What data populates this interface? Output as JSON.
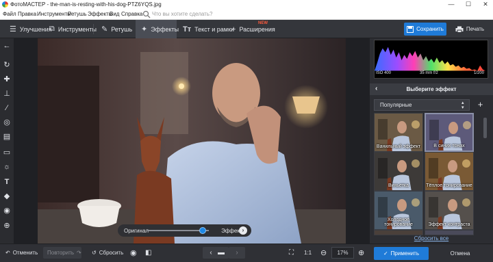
{
  "app": {
    "title": "ФотоМАСТЕР - the-man-is-resting-with-his-dog-PTZ6YQS.jpg"
  },
  "window_controls": {
    "minimize": "—",
    "maximize": "☐",
    "close": "✕"
  },
  "menu": {
    "items": [
      "Файл",
      "Правка",
      "Инструменты",
      "Ретушь",
      "Эффекты",
      "Вид",
      "Справка"
    ],
    "search_placeholder": "Что вы хотите сделать?"
  },
  "toolbar": {
    "tabs": [
      {
        "label": "Улучшения",
        "icon": "sliders-icon"
      },
      {
        "label": "Инструменты",
        "icon": "crop-icon"
      },
      {
        "label": "Ретушь",
        "icon": "brush-icon"
      },
      {
        "label": "Эффекты",
        "icon": "magic-wand-icon"
      },
      {
        "label": "Текст и рамки",
        "icon": "text-icon"
      },
      {
        "label": "Расширения",
        "icon": "plus-icon"
      }
    ],
    "new_badge": "NEW",
    "save_label": "Сохранить",
    "print_label": "Печать"
  },
  "left_tools": [
    "back-arrow-icon",
    "rotate-icon",
    "healing-patch-icon",
    "stamp-icon",
    "brush-icon",
    "radial-filter-icon",
    "gradient-filter-icon",
    "vignette-icon",
    "light-icon",
    "text-icon",
    "fill-icon",
    "red-eye-icon",
    "target-icon"
  ],
  "compare": {
    "left_label": "Оригинал",
    "right_label": "Эффект",
    "position": 0.9
  },
  "histogram": {
    "iso": "ISO 400",
    "lens": "35 mm f/2",
    "shutter": "1/200"
  },
  "effects": {
    "header": "Выберите эффект",
    "category": "Популярные",
    "thumbs": [
      {
        "label": "Ванильный эффект",
        "selected": false
      },
      {
        "label": "В синих тонах",
        "selected": true
      },
      {
        "label": "Виньетка",
        "selected": false
      },
      {
        "label": "Тёплое тонирование",
        "selected": false
      },
      {
        "label": "Холодное тонирование",
        "selected": false
      },
      {
        "label": "Эффект контраста",
        "selected": false
      },
      {
        "label": "",
        "selected": false
      },
      {
        "label": "",
        "selected": false
      }
    ],
    "reset_all": "Сбросить все"
  },
  "bottom": {
    "undo": "Отменить",
    "redo": "Повторить",
    "reset": "Сбросить",
    "ratio": "1:1",
    "zoom": "17%",
    "apply": "Применить",
    "cancel": "Отмена"
  },
  "colors": {
    "accent": "#1f7bd8",
    "new_badge": "#ff5a3c"
  }
}
